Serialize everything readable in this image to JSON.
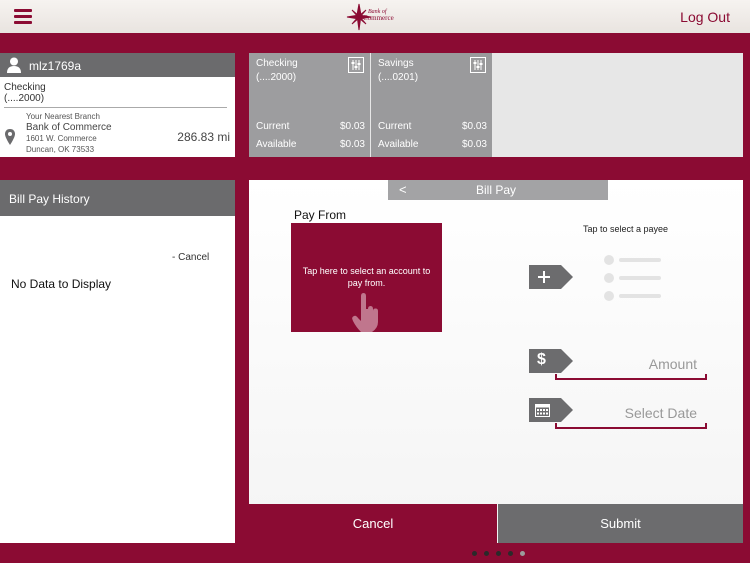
{
  "header": {
    "logo_line1": "Bank of",
    "logo_line2": "Commerce",
    "logout_label": "Log Out"
  },
  "user": {
    "username": "mlz1769a",
    "account_name": "Checking",
    "account_number": "(....2000)",
    "branch_label": "Your Nearest Branch",
    "branch_name": "Bank of Commerce",
    "branch_address_1": "1601 W. Commerce",
    "branch_address_2": "Duncan, OK 73533",
    "branch_distance": "286.83 mi"
  },
  "accounts": [
    {
      "name": "Checking",
      "number": "(....2000)",
      "current_label": "Current",
      "current": "$0.03",
      "available_label": "Available",
      "available": "$0.03"
    },
    {
      "name": "Savings",
      "number": "(....0201)",
      "current_label": "Current",
      "current": "$0.03",
      "available_label": "Available",
      "available": "$0.03"
    }
  ],
  "history": {
    "title": "Bill Pay History",
    "cancel_label": "- Cancel",
    "empty_text": "No Data to Display"
  },
  "billpay": {
    "back_label": "<",
    "title": "Bill Pay",
    "pay_from_label": "Pay From",
    "pay_from_prompt": "Tap here to select an account to pay from.",
    "payee_prompt": "Tap to select a payee",
    "amount_placeholder": "Amount",
    "date_placeholder": "Select Date",
    "cancel_label": "Cancel",
    "submit_label": "Submit"
  },
  "pager": {
    "count": 5,
    "active_index": 4
  },
  "colors": {
    "brand": "#8b0b33",
    "gray_header": "#6b6b6d",
    "tile_gray": "#9d9d9f"
  },
  "icons": [
    "menu-icon",
    "person-icon",
    "map-pin-icon",
    "sliders-icon",
    "hand-pointer-icon",
    "plus-icon",
    "dollar-icon",
    "calendar-icon"
  ]
}
